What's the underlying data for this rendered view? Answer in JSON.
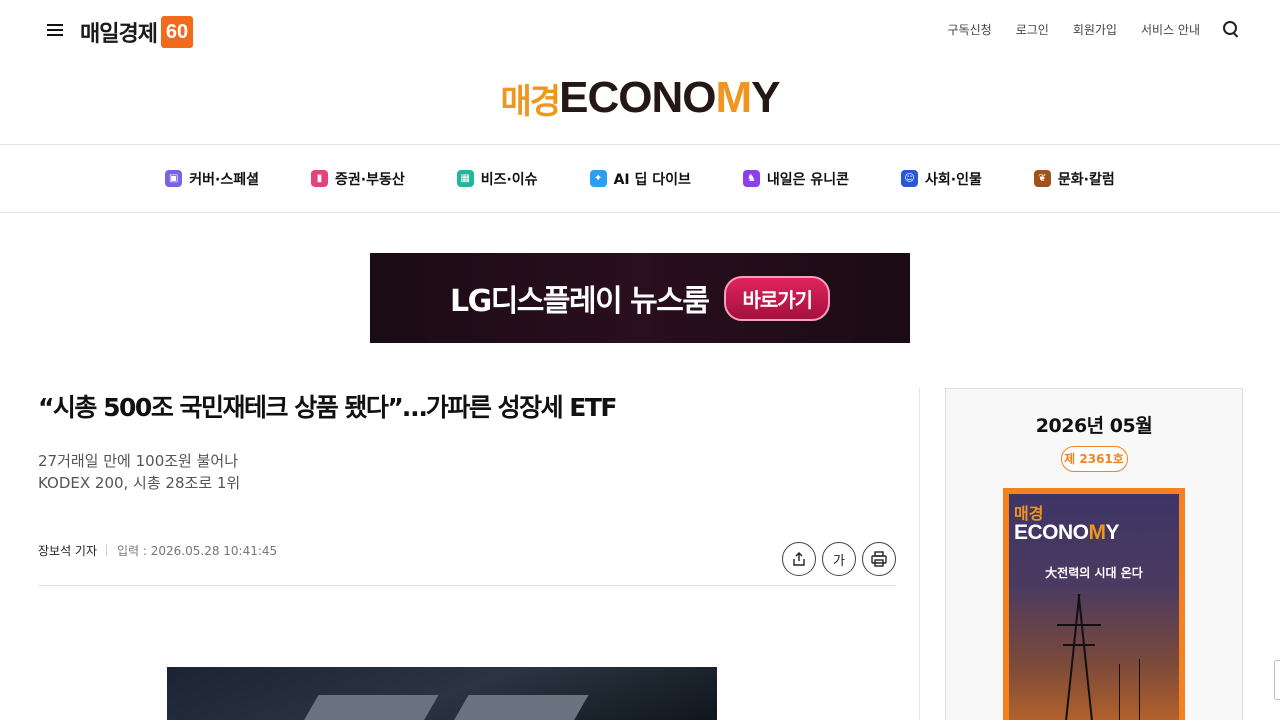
{
  "header": {
    "logo_text": "매일경제",
    "logo_badge": "60",
    "util_links": [
      "구독신청",
      "로그인",
      "회원가입",
      "서비스 안내"
    ]
  },
  "brand": {
    "ko": "매경",
    "en_pre": "ECONO",
    "en_m": "M",
    "en_post": "Y"
  },
  "nav": [
    {
      "label": "커버·스페셜",
      "color": "#7b61e8",
      "icon": "cube-icon"
    },
    {
      "label": "증권·부동산",
      "color": "#e8407a",
      "icon": "bar-chart-icon"
    },
    {
      "label": "비즈·이슈",
      "color": "#1fb89a",
      "icon": "building-icon"
    },
    {
      "label": "AI 딥 다이브",
      "color": "#2a9df4",
      "icon": "sparkle-icon"
    },
    {
      "label": "내일은 유니콘",
      "color": "#8a3ff0",
      "icon": "unicorn-icon"
    },
    {
      "label": "사회·인물",
      "color": "#2957d8",
      "icon": "person-card-icon"
    },
    {
      "label": "문화·칼럼",
      "color": "#a0521a",
      "icon": "leaf-icon"
    }
  ],
  "ad": {
    "text": "LG디스플레이 뉴스룸",
    "button": "바로가기"
  },
  "article": {
    "headline": "“시총 500조 국민재테크 상품 됐다”…가파른 성장세 ETF",
    "subhead_lines": [
      "27거래일 만에 100조원 불어나",
      "KODEX 200, 시총 28조로 1위"
    ],
    "author": "장보석 기자",
    "date": "입력 : 2026.05.28 10:41:45",
    "tools": {
      "font_size_label": "가"
    }
  },
  "sidebar": {
    "month": "2026년 05월",
    "issue": "제 2361호",
    "cover": {
      "ko": "매경",
      "en_pre": "ECONO",
      "en_m": "M",
      "en_post": "Y",
      "headline": "大전력의 시대 온다"
    }
  }
}
